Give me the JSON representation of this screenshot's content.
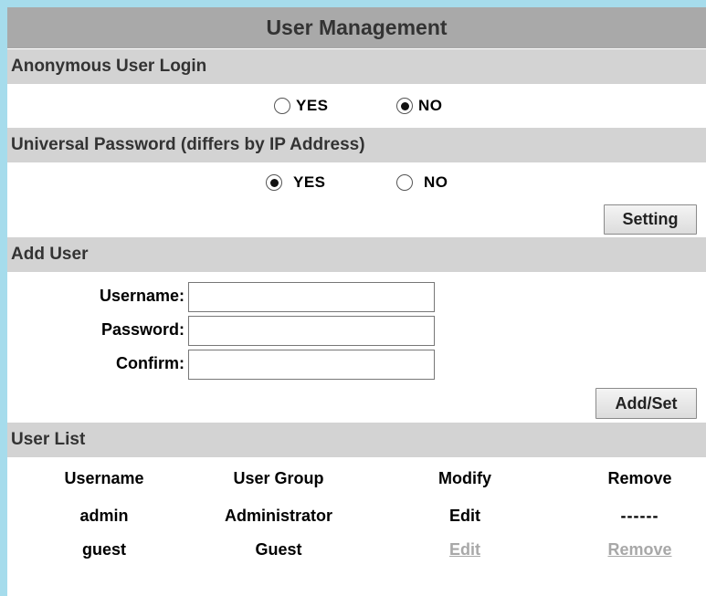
{
  "title": "User Management",
  "anonymous": {
    "header": "Anonymous User Login",
    "options": [
      {
        "label": "YES",
        "selected": false
      },
      {
        "label": "NO",
        "selected": true
      }
    ]
  },
  "universal": {
    "header": "Universal Password (differs by IP Address)",
    "options": [
      {
        "label": "YES",
        "selected": true
      },
      {
        "label": "NO",
        "selected": false
      }
    ],
    "setting_label": "Setting"
  },
  "add_user": {
    "header": "Add User",
    "username_label": "Username:",
    "username_value": "",
    "password_label": "Password:",
    "password_value": "",
    "confirm_label": "Confirm:",
    "confirm_value": "",
    "submit_label": "Add/Set"
  },
  "user_list": {
    "header": "User List",
    "columns": [
      "Username",
      "User Group",
      "Modify",
      "Remove"
    ],
    "rows": [
      {
        "username": "admin",
        "group": "Administrator",
        "modify": "Edit",
        "remove": "------"
      },
      {
        "username": "guest",
        "group": "Guest",
        "modify": "Edit",
        "remove": "Remove"
      }
    ]
  },
  "colors": {
    "frame": "#a6dcec",
    "title_bg": "#a9a9a9",
    "section_bg": "#d3d3d3",
    "link_gray": "#b0b0b0"
  }
}
